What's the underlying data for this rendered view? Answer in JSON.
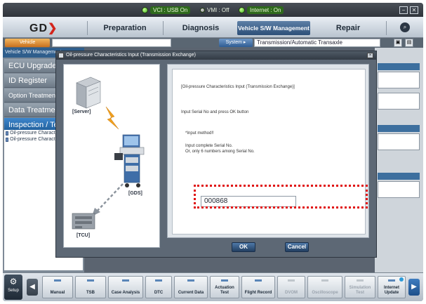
{
  "status": {
    "vci": "VCI : USB On",
    "vmi": "VMI : Off",
    "internet": "Internet : On"
  },
  "window": {
    "minimize": "−",
    "close": "✕"
  },
  "nav": {
    "logo_text": "GD",
    "tabs": [
      {
        "label": "Preparation"
      },
      {
        "label": "Diagnosis"
      },
      {
        "label": "Vehicle S/W Management"
      },
      {
        "label": "Repair"
      }
    ]
  },
  "subbar": {
    "vehicle_button": "Vehicle",
    "system_button": "System ▸",
    "system_value": "Transmission/Automatic Transaxle"
  },
  "sidebar": {
    "header": "Vehicle S/W Management",
    "items": [
      {
        "label": "ECU Upgrade"
      },
      {
        "label": "ID Register"
      },
      {
        "label": "Option Treatment"
      },
      {
        "label": "Data Treatment"
      },
      {
        "label": "Inspection / Test"
      }
    ],
    "list": [
      {
        "label": "Oil-pressure Characteristics Input"
      },
      {
        "label": "Oil-pressure Characteristics Input"
      }
    ]
  },
  "dialog": {
    "title": "Oil-pressure Characteristics Input (Transmission Exchange)",
    "heading": "[Oil-pressure Characteristics Input (Transmission Exchange)]",
    "instruction": "Input Serial No and press OK button",
    "method_title": "*Input method!!",
    "method_line1": "Input complete Serial No.",
    "method_line2": "Or, only 6 numbers among Serial No.",
    "serial_value": "000868",
    "ok_label": "OK",
    "cancel_label": "Cancel",
    "illustration": {
      "server_label": "[Server]",
      "gds_label": "[GDS]",
      "tcu_label": "[TCU]"
    }
  },
  "toolbar": {
    "setup_label": "Setup",
    "items": [
      {
        "label": "Manual"
      },
      {
        "label": "TSB"
      },
      {
        "label": "Case Analysis"
      },
      {
        "label": "DTC"
      },
      {
        "label": "Current Data"
      },
      {
        "label": "Actuation Test"
      },
      {
        "label": "Flight Record"
      },
      {
        "label": "DVOM"
      },
      {
        "label": "Oscilloscope"
      },
      {
        "label": "Simulation Test"
      },
      {
        "label": "Internet Update"
      }
    ]
  },
  "colors": {
    "accent_blue": "#2c4f78",
    "highlight_red": "#e01010",
    "status_green": "#3bb020"
  }
}
